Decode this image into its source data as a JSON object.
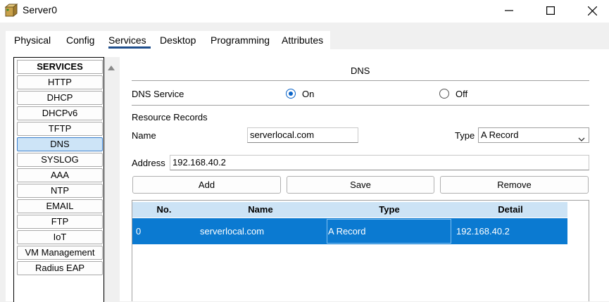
{
  "window": {
    "title": "Server0"
  },
  "tabs": [
    {
      "label": "Physical"
    },
    {
      "label": "Config"
    },
    {
      "label": "Services"
    },
    {
      "label": "Desktop"
    },
    {
      "label": "Programming"
    },
    {
      "label": "Attributes"
    }
  ],
  "active_tab": "Services",
  "sidebar": {
    "header": "SERVICES",
    "items": [
      {
        "label": "HTTP"
      },
      {
        "label": "DHCP"
      },
      {
        "label": "DHCPv6"
      },
      {
        "label": "TFTP"
      },
      {
        "label": "DNS"
      },
      {
        "label": "SYSLOG"
      },
      {
        "label": "AAA"
      },
      {
        "label": "NTP"
      },
      {
        "label": "EMAIL"
      },
      {
        "label": "FTP"
      },
      {
        "label": "IoT"
      },
      {
        "label": "VM Management"
      },
      {
        "label": "Radius EAP"
      }
    ],
    "active_item": "DNS"
  },
  "dns": {
    "title": "DNS",
    "service_label": "DNS Service",
    "on_label": "On",
    "off_label": "Off",
    "service_state": "On",
    "resource_records_label": "Resource Records",
    "name_label": "Name",
    "name_value": "serverlocal.com",
    "type_label": "Type",
    "type_value": "A Record",
    "address_label": "Address",
    "address_value": "192.168.40.2",
    "buttons": {
      "add": "Add",
      "save": "Save",
      "remove": "Remove"
    }
  },
  "table": {
    "columns": [
      "No.",
      "Name",
      "Type",
      "Detail"
    ],
    "rows": [
      {
        "no": "0",
        "name": "serverlocal.com",
        "type": "A Record",
        "detail": "192.168.40.2"
      }
    ]
  },
  "colors": {
    "accent": "#0b7ad1",
    "header_bg": "#cce3f5",
    "active_service": "#cde4f7",
    "tab_underline": "#1f4e8c"
  }
}
